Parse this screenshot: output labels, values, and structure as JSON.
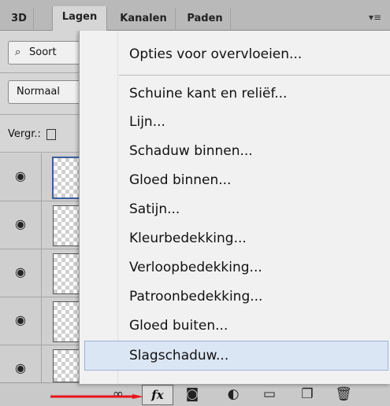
{
  "tabs": [
    {
      "label": "3D",
      "active": false
    },
    {
      "label": "Lagen",
      "active": true
    },
    {
      "label": "Kanalen",
      "active": false
    },
    {
      "label": "Paden",
      "active": false
    }
  ],
  "panel_menu_icon": "panel-menu-icon",
  "filter": {
    "label": "Soort"
  },
  "blend_mode": {
    "value": "Normaal"
  },
  "lock": {
    "label": "Vergr.:"
  },
  "layers_count": 5,
  "menu": {
    "items": [
      {
        "label": "Opties voor overvloeien...",
        "highlighted": false
      },
      {
        "label": "Schuine kant en reliëf...",
        "highlighted": false
      },
      {
        "label": "Lijn...",
        "highlighted": false
      },
      {
        "label": "Schaduw binnen...",
        "highlighted": false
      },
      {
        "label": "Gloed binnen...",
        "highlighted": false
      },
      {
        "label": "Satijn...",
        "highlighted": false
      },
      {
        "label": "Kleurbedekking...",
        "highlighted": false
      },
      {
        "label": "Verloopbedekking...",
        "highlighted": false
      },
      {
        "label": "Patroonbedekking...",
        "highlighted": false
      },
      {
        "label": "Gloed buiten...",
        "highlighted": false
      },
      {
        "label": "Slagschaduw...",
        "highlighted": true
      }
    ]
  },
  "bottom_bar": {
    "fx_label": "fx",
    "icons": [
      "link-icon",
      "fx-icon",
      "mask-icon",
      "adjustment-icon",
      "group-folder-icon",
      "new-layer-icon",
      "trash-icon"
    ]
  },
  "colors": {
    "highlight": "#dbe6f4",
    "arrow": "#e8141b",
    "selection_border": "#3b5f9e"
  }
}
